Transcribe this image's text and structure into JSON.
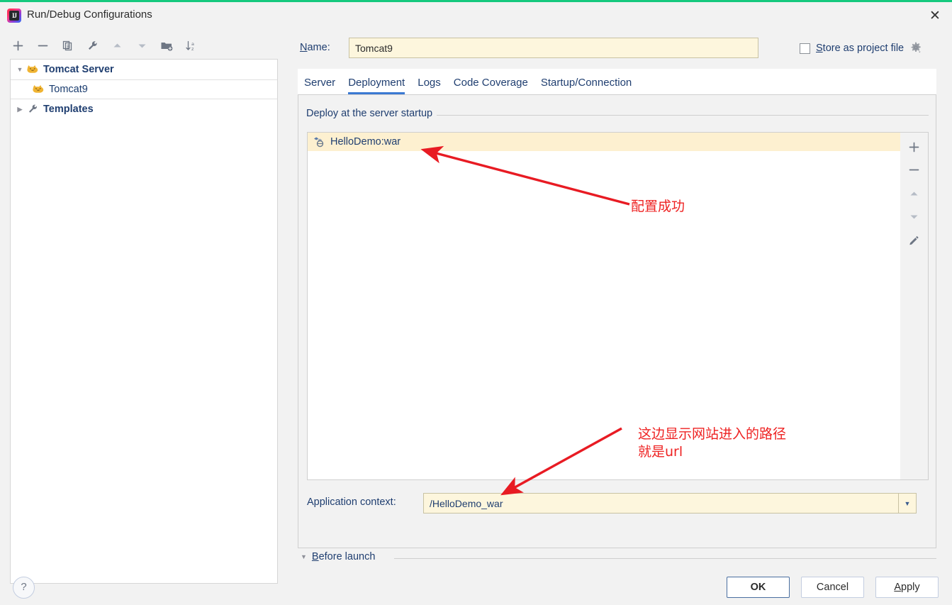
{
  "window": {
    "title": "Run/Debug Configurations",
    "logo_text": "IJ",
    "close_icon": "close-icon",
    "accent_top": "#16c97e"
  },
  "left_toolbar": {
    "buttons": [
      {
        "name": "add",
        "icon": "plus-icon",
        "enabled": true
      },
      {
        "name": "remove",
        "icon": "minus-icon",
        "enabled": true
      },
      {
        "name": "copy",
        "icon": "copy-icon",
        "enabled": true
      },
      {
        "name": "edit-templates",
        "icon": "wrench-icon",
        "enabled": true
      },
      {
        "name": "move-up",
        "icon": "arrow-up-icon",
        "enabled": false
      },
      {
        "name": "move-down",
        "icon": "arrow-down-icon",
        "enabled": false
      },
      {
        "name": "new-folder",
        "icon": "folder-add-icon",
        "enabled": true
      },
      {
        "name": "sort-alphabetically",
        "icon": "sort-az-icon",
        "enabled": true
      }
    ]
  },
  "tree": {
    "items": [
      {
        "label": "Tomcat Server",
        "icon": "tomcat-cat-icon",
        "type": "group",
        "expanded": true,
        "selected": false
      },
      {
        "label": "Tomcat9",
        "icon": "tomcat-cat-icon",
        "type": "child",
        "expanded": false,
        "selected": true
      },
      {
        "label": "Templates",
        "icon": "wrench-icon",
        "type": "group",
        "expanded": false,
        "selected": false
      }
    ]
  },
  "name_field": {
    "label": "Name:",
    "label_mnemonic": "N",
    "value": "Tomcat9",
    "placeholder": ""
  },
  "store_as_project_file": {
    "label": "Store as project file",
    "label_mnemonic": "S",
    "checked": false,
    "gear_icon": "gear-icon"
  },
  "tabs": [
    {
      "label": "Server",
      "active": false
    },
    {
      "label": "Deployment",
      "active": true
    },
    {
      "label": "Logs",
      "active": false
    },
    {
      "label": "Code Coverage",
      "active": false
    },
    {
      "label": "Startup/Connection",
      "active": false
    }
  ],
  "deployment": {
    "group_label": "Deploy at the server startup",
    "rows": [
      {
        "label": "HelloDemo:war",
        "icon": "artifact-icon",
        "selected": true
      }
    ],
    "actions": [
      {
        "name": "add-artifact",
        "icon": "plus-icon",
        "enabled": true
      },
      {
        "name": "remove-artifact",
        "icon": "minus-icon",
        "enabled": true
      },
      {
        "name": "move-artifact-up",
        "icon": "arrow-up-icon",
        "enabled": false
      },
      {
        "name": "move-artifact-down",
        "icon": "arrow-down-icon",
        "enabled": false
      },
      {
        "name": "edit-artifact",
        "icon": "pencil-icon",
        "enabled": true
      }
    ],
    "application_context": {
      "label": "Application context:",
      "value": "/HelloDemo_war",
      "dropdown_icon": "chevron-down-icon"
    }
  },
  "before_launch": {
    "label": "Before launch",
    "label_mnemonic": "B",
    "expanded": true
  },
  "footer": {
    "help_label": "?",
    "ok_label": "OK",
    "cancel_label": "Cancel",
    "apply_label": "Apply",
    "apply_mnemonic": "A"
  },
  "annotations": {
    "color": "#ee2222",
    "items": [
      {
        "text": "配置成功"
      },
      {
        "text": "这边显示网站进入的路径\n就是url"
      }
    ]
  }
}
